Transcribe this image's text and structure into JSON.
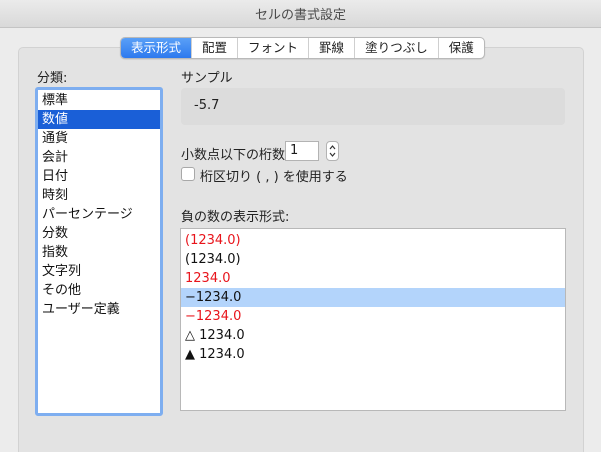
{
  "window": {
    "title": "セルの書式設定"
  },
  "tabs": [
    {
      "label": "表示形式",
      "active": true
    },
    {
      "label": "配置",
      "active": false
    },
    {
      "label": "フォント",
      "active": false
    },
    {
      "label": "罫線",
      "active": false
    },
    {
      "label": "塗りつぶし",
      "active": false
    },
    {
      "label": "保護",
      "active": false
    }
  ],
  "category": {
    "label": "分類:",
    "items": [
      "標準",
      "数値",
      "通貨",
      "会計",
      "日付",
      "時刻",
      "パーセンテージ",
      "分数",
      "指数",
      "文字列",
      "その他",
      "ユーザー定義"
    ],
    "selected_index": 1
  },
  "sample": {
    "label": "サンプル",
    "value": "-5.7"
  },
  "decimal_places": {
    "label": "小数点以下の桁数:",
    "value": "1"
  },
  "thousands_separator": {
    "label": "桁区切り ( , ) を使用する",
    "checked": false
  },
  "negative_format": {
    "label": "負の数の表示形式:",
    "items": [
      {
        "text": "(1234.0)",
        "color": "red"
      },
      {
        "text": "(1234.0)",
        "color": "black"
      },
      {
        "text": "1234.0",
        "color": "red"
      },
      {
        "text": "−1234.0",
        "color": "black"
      },
      {
        "text": "−1234.0",
        "color": "red"
      },
      {
        "text": "△ 1234.0",
        "color": "black"
      },
      {
        "text": "▲ 1234.0",
        "color": "black"
      }
    ],
    "selected_index": 3
  },
  "colors": {
    "accent": "#2d79ee",
    "selection": "#1a5fd7",
    "negative_red": "#e8141b",
    "list_highlight": "#b3d4fb"
  }
}
